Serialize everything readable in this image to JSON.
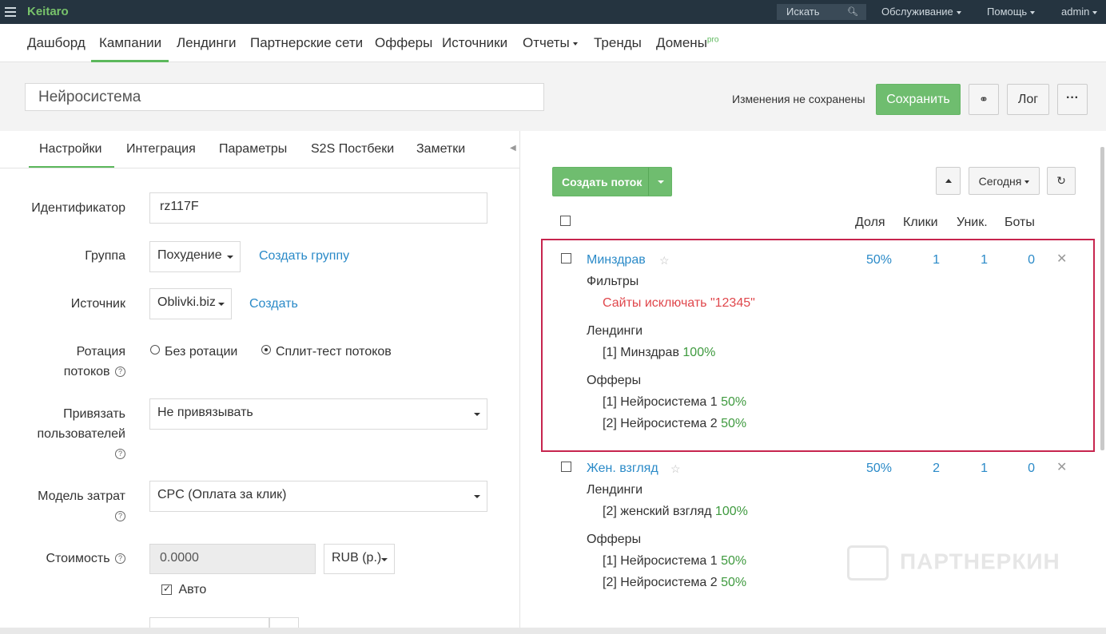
{
  "topbar": {
    "brand": "Keitaro",
    "search_placeholder": "Искать",
    "service": "Обслуживание",
    "help": "Помощь",
    "user": "admin"
  },
  "mainnav": {
    "items": [
      "Дашборд",
      "Кампании",
      "Лендинги",
      "Партнерские сети",
      "Офферы",
      "Источники",
      "Отчеты",
      "Тренды",
      "Домены"
    ],
    "pro": "pro",
    "active": "Кампании"
  },
  "campaign": {
    "name": "Нейросистема",
    "unsaved_text": "Изменения не сохранены",
    "save_label": "Сохранить",
    "log_label": "Лог",
    "more_label": "···"
  },
  "tabs": [
    "Настройки",
    "Интеграция",
    "Параметры",
    "S2S Постбеки",
    "Заметки"
  ],
  "form": {
    "id_label": "Идентификатор",
    "id_value": "rz117F",
    "group_label": "Группа",
    "group_value": "Похудение",
    "create_group": "Создать группу",
    "source_label": "Источник",
    "source_value": "Oblivki.biz",
    "create_source": "Создать",
    "rotation_label_1": "Ротация",
    "rotation_label_2": "потоков",
    "rotation_opt1": "Без ротации",
    "rotation_opt2": "Сплит-тест потоков",
    "bind_label_1": "Привязать",
    "bind_label_2": "пользователей",
    "bind_value": "Не привязывать",
    "cost_model_label_1": "Модель затрат",
    "cost_model_value": "CPC (Оплата за клик)",
    "cost_label": "Стоимость",
    "cost_value": "0.0000",
    "currency": "RUB (р.)",
    "auto_label": "Авто",
    "help_mark": "?"
  },
  "flows_toolbar": {
    "create_label": "Создать поток",
    "today_label": "Сегодня",
    "refresh_icon": "↻"
  },
  "columns": {
    "share": "Доля",
    "clicks": "Клики",
    "uniq": "Уник.",
    "bots": "Боты"
  },
  "flows": [
    {
      "name": "Минздрав",
      "share": "50%",
      "clicks": "1",
      "uniq": "1",
      "bots": "0",
      "filters_label": "Фильтры",
      "filter": "Сайты исключать \"12345\"",
      "landings_label": "Лендинги",
      "landing": "[1] Минздрав",
      "landing_pct": "100%",
      "offers_label": "Офферы",
      "offer1": "[1] Нейросистема 1",
      "offer1_pct": "50%",
      "offer2": "[2] Нейросистема 2",
      "offer2_pct": "50%"
    },
    {
      "name": "Жен. взгляд",
      "share": "50%",
      "clicks": "2",
      "uniq": "1",
      "bots": "0",
      "landings_label": "Лендинги",
      "landing": "[2] женский взгляд",
      "landing_pct": "100%",
      "offers_label": "Офферы",
      "offer1": "[1] Нейросистема 1",
      "offer1_pct": "50%",
      "offer2": "[2] Нейросистема 2",
      "offer2_pct": "50%"
    }
  ],
  "watermark": "ПАРТНЕРКИН",
  "colors": {
    "accent_green": "#6fbd6f",
    "link_blue": "#2a8ac8",
    "filter_red": "#e0474c",
    "highlight_box": "#c7254e",
    "topbar_bg": "#253440"
  }
}
